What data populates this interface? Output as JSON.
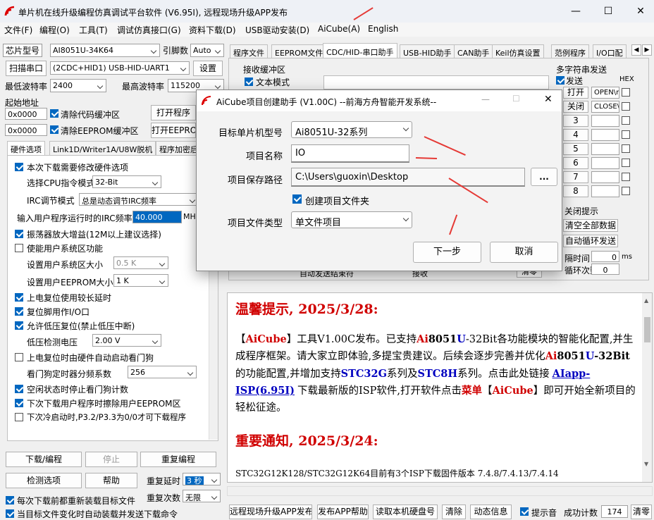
{
  "window": {
    "title": "单片机在线升级编程仿真调试平台软件 (V6.95I), 远程现场升级APP发布",
    "min": "—",
    "max": "☐",
    "close": "✕"
  },
  "menu": [
    "文件(F)",
    "编程(O)",
    "工具(T)",
    "调试仿真接口(G)",
    "资料下载(D)",
    "USB驱动安装(D)",
    "AiCube(A)",
    "English"
  ],
  "left": {
    "chip_label": "芯片型号",
    "chip_value": "AI8051U-34K64",
    "pin_label": "引脚数",
    "pin_value": "Auto",
    "scan_button": "扫描串口",
    "port_value": "(2CDC+HID1) USB-HID-UART1",
    "settings_button": "设置",
    "min_baud_label": "最低波特率",
    "min_baud_value": "2400",
    "max_baud_label": "最高波特率",
    "max_baud_value": "115200",
    "start_addr_label": "起始地址",
    "addr1": "0x0000",
    "clear_code": "清除代码缓冲区",
    "open_program": "打开程序",
    "addr2": "0x0000",
    "clear_eeprom": "清除EEPROM缓冲区",
    "open_eeprom": "打开EEPROM",
    "tabs": [
      "硬件选项",
      "Link1D/Writer1A/U8W脱机",
      "程序加密后"
    ],
    "options": {
      "modify_hw": "本次下载需要修改硬件选项",
      "cpu_label": "选择CPU指令模式",
      "cpu_value": "32-Bit",
      "irc_label": "IRC调节模式",
      "irc_value": "总是动态调节IRC频率",
      "freq_label": "输入用户程序运行时的IRC频率",
      "freq_value": "40.000",
      "freq_unit": "MHz",
      "osc_gain": "振荡器放大增益(12M以上建议选择)",
      "use_sys": "使能用户系统区功能",
      "sys_size_label": "设置用户系统区大小",
      "sys_size_value": "0.5 K",
      "eeprom_size_label": "设置用户EEPROM大小",
      "eeprom_size_value": "1  K",
      "long_delay": "上电复位使用较长延时",
      "reset_io": "复位脚用作I/O口",
      "lvr": "允许低压复位(禁止低压中断)",
      "lvd_label": "低压检测电压",
      "lvd_value": "2.00 V",
      "wdt_auto": "上电复位时由硬件自动启动看门狗",
      "wdt_div_label": "看门狗定时器分频系数",
      "wdt_div_value": "256",
      "idle_wdt": "空闲状态时停止看门狗计数",
      "erase_eeprom": "下次下载用户程序时擦除用户EEPROM区",
      "p32": "下次冷启动时,P3.2/P3.3为0/0才可下载程序"
    },
    "download_button": "下载/编程",
    "stop_button": "停止",
    "reprogram_button": "重复编程",
    "check_button": "检测选项",
    "help_button": "帮助",
    "repeat_delay_label": "重复延时",
    "repeat_delay_value": "3 秒",
    "repeat_count_label": "重复次数",
    "repeat_count_value": "无限",
    "reload_each": "每次下载前都重新装载目标文件",
    "auto_send": "当目标文件变化时自动装载并发送下载命令"
  },
  "right": {
    "tabs": [
      "程序文件",
      "EEPROM文件",
      "CDC/HID-串口助手",
      "USB-HID助手",
      "CAN助手",
      "Keil仿真设置",
      "范例程序",
      "I/O口配"
    ],
    "recv_label": "接收缓冲区",
    "text_mode": "文本模式",
    "multi_label": "多字符串发送",
    "send_label": "发送",
    "hex_label": "HEX",
    "open_btn": "打开",
    "open_cmd": "OPEN\\r",
    "close_btn": "关闭",
    "close_cmd": "CLOSE\\",
    "rows": [
      "3",
      "4",
      "5",
      "6",
      "7",
      "8"
    ],
    "close_tip": "关闭提示",
    "clear_all": "清空全部数据",
    "auto_loop": "自动循环发送",
    "interval_label": "隔时间",
    "interval_value": "0",
    "interval_unit": "ms",
    "loop_label": "循环次数",
    "loop_value": "0",
    "recv2": "接收",
    "clear2": "清零",
    "auto_send2": "自动发送结束符"
  },
  "notice": {
    "h1": "温馨提示, 2025/3/28:",
    "p1a": "【",
    "p1b": "AiCube",
    "p1c": "】工具V1.00C发布。已支持",
    "p1d": "Ai",
    "p1e": "8051",
    "p1f": "U",
    "p1g": "-32Bit各功能模块的智能化配置,并生成程序框架。请大家立即体验,多提宝贵建议。后续会逐步完善并优化",
    "p1h": "Ai",
    "p1i": "8051",
    "p1j": "U",
    "p1k": "-32Bit",
    "p1l": "的功能配置,并增加支持",
    "p1m": "STC32G",
    "p1n": "系列及",
    "p1o": "STC8H",
    "p1p": "系列。点击此处链接",
    "p1q": "AIapp-ISP(6.95I)",
    "p1r": "下载最新版的ISP软件,打开软件点击",
    "p1s": "菜单",
    "p1t": "【",
    "p1u": "AiCube",
    "p1v": "】即可开始全新项目的轻松征途。",
    "h2": "重要通知, 2025/3/24:",
    "p2": "STC32G12K128/STC32G12K64目前有3个ISP下载固件版本 7.4.8/7.4.13/7.4.14"
  },
  "bottom": {
    "remote": "远程现场升级APP发布",
    "publish": "发布APP帮助",
    "read_disk": "读取本机硬盘号",
    "clear": "清除",
    "dynamic": "动态信息",
    "beep": "提示音",
    "success_label": "成功计数",
    "success_value": "174",
    "clear_zero": "清零"
  },
  "dialog": {
    "title": "AiCube项目创建助手 (V1.00C) --前海方舟智能开发系统--",
    "target_label": "目标单片机型号",
    "target_value": "Ai8051U-32系列",
    "name_label": "项目名称",
    "name_value": "IO",
    "path_label": "项目保存路径",
    "path_value": "C:\\Users\\guoxin\\Desktop",
    "browse": "...",
    "create_folder": "创建项目文件夹",
    "type_label": "项目文件类型",
    "type_value": "单文件项目",
    "next": "下一步",
    "cancel": "取消"
  },
  "colors": {
    "accent": "#0067c0",
    "annotation": "#e53935",
    "notice_red": "#d00000",
    "notice_blue": "#0000c0"
  }
}
